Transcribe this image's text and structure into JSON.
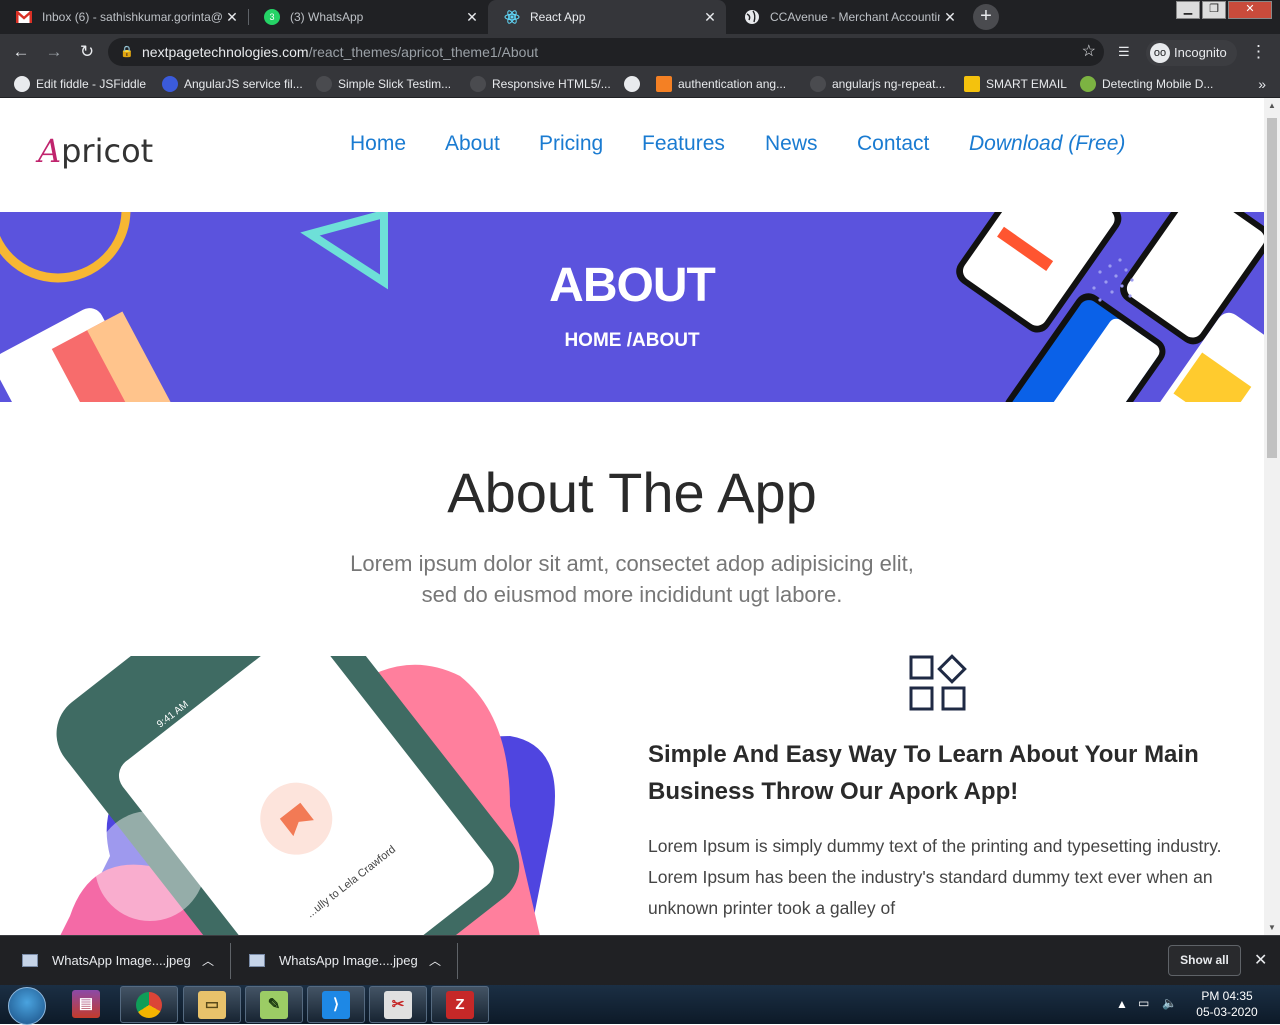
{
  "browser": {
    "tabs": [
      {
        "title": "Inbox (6) - sathishkumar.gorinta@",
        "icon": "gmail-icon",
        "active": false
      },
      {
        "title": "(3) WhatsApp",
        "icon": "whatsapp-icon",
        "active": false
      },
      {
        "title": "React App",
        "icon": "react-icon",
        "active": true
      },
      {
        "title": "CCAvenue - Merchant Accounting",
        "icon": "globe-icon",
        "active": false
      }
    ],
    "new_tab_label": "+",
    "url_host": "nextpagetechnologies.com",
    "url_path": "/react_themes/apricot_theme1/About",
    "profile_label": "Incognito"
  },
  "bookmarks": [
    {
      "label": "Edit fiddle - JSFiddle",
      "color": "#e8eaed"
    },
    {
      "label": "AngularJS service fil...",
      "color": "#3b5bdb"
    },
    {
      "label": "Simple Slick Testim...",
      "color": "#5f6368"
    },
    {
      "label": "Responsive HTML5/...",
      "color": "#5f6368"
    },
    {
      "label": "",
      "color": "#e8eaed"
    },
    {
      "label": "authentication ang...",
      "color": "#f48024"
    },
    {
      "label": "angularjs ng-repeat...",
      "color": "#5f6368"
    },
    {
      "label": "SMART EMAIL",
      "color": "#f4c20d"
    },
    {
      "label": "Detecting Mobile D...",
      "color": "#7cb342"
    }
  ],
  "site": {
    "logo_first": "A",
    "logo_rest": "pricot",
    "nav": [
      "Home",
      "About",
      "Pricing",
      "Features",
      "News",
      "Contact",
      "Download (Free)"
    ],
    "hero_title": "ABOUT",
    "hero_breadcrumb": "HOME /ABOUT",
    "section_title": "About The App",
    "section_subtitle": "Lorem ipsum dolor sit amt, consectet adop adipisicing elit, sed do eiusmod more incididunt ugt labore.",
    "feature_heading": "Simple And Easy Way To Learn About Your Main Business Throw Our Apork App!",
    "feature_text": "Lorem Ipsum is simply dummy text of the printing and typesetting industry. Lorem Ipsum has been the industry's standard dummy text ever when an unknown printer took a galley of",
    "phone_time": "9:41 AM",
    "phone_name": "...ully to Lela Crawford",
    "accent": "#5b53dd",
    "link_color": "#1a7bd1"
  },
  "downloads": {
    "items": [
      "WhatsApp Image....jpeg",
      "WhatsApp Image....jpeg"
    ],
    "show_all": "Show all"
  },
  "taskbar": {
    "apps": [
      "chrome-icon",
      "file-explorer-icon",
      "notepad-plus-plus-icon",
      "vscode-icon",
      "snipping-tool-icon",
      "filezilla-icon"
    ],
    "time": "PM 04:35",
    "date": "05-03-2020"
  }
}
